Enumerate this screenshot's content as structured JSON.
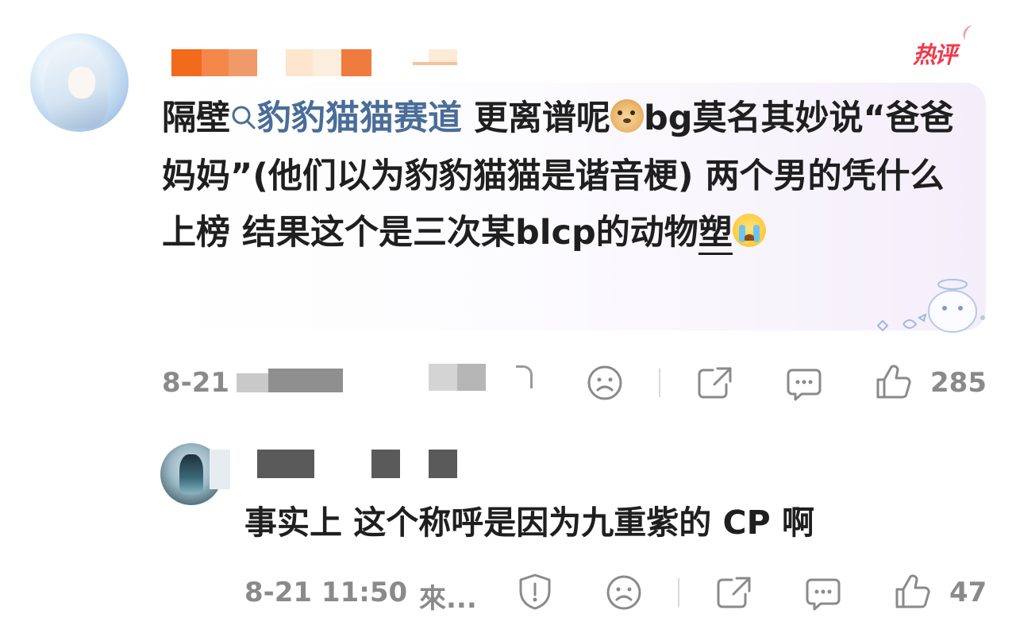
{
  "main_comment": {
    "badge": "热评",
    "text_prefix": "隔壁",
    "hashtag": "豹豹猫猫赛道",
    "text_line1_after": " 更离谱呢",
    "text_mid": "bg莫名其妙说“爸爸妈妈”(他们以为豹豹猫猫是谐音梗) 两个男的凭什么上榜 结果这个是三次某blcp的动物",
    "text_end": "塑",
    "timestamp": "8-21",
    "like_count": "285"
  },
  "reply": {
    "text": "事实上 这个称呼是因为九重紫的 CP 啊",
    "timestamp": "8-21 11:50",
    "source": "來...",
    "like_count": "47"
  },
  "icons": {
    "main": [
      "frown-icon",
      "share-icon",
      "comment-icon",
      "thumbs-up-icon"
    ],
    "reply": [
      "report-icon",
      "frown-icon",
      "share-icon",
      "comment-icon",
      "thumbs-up-icon"
    ]
  }
}
